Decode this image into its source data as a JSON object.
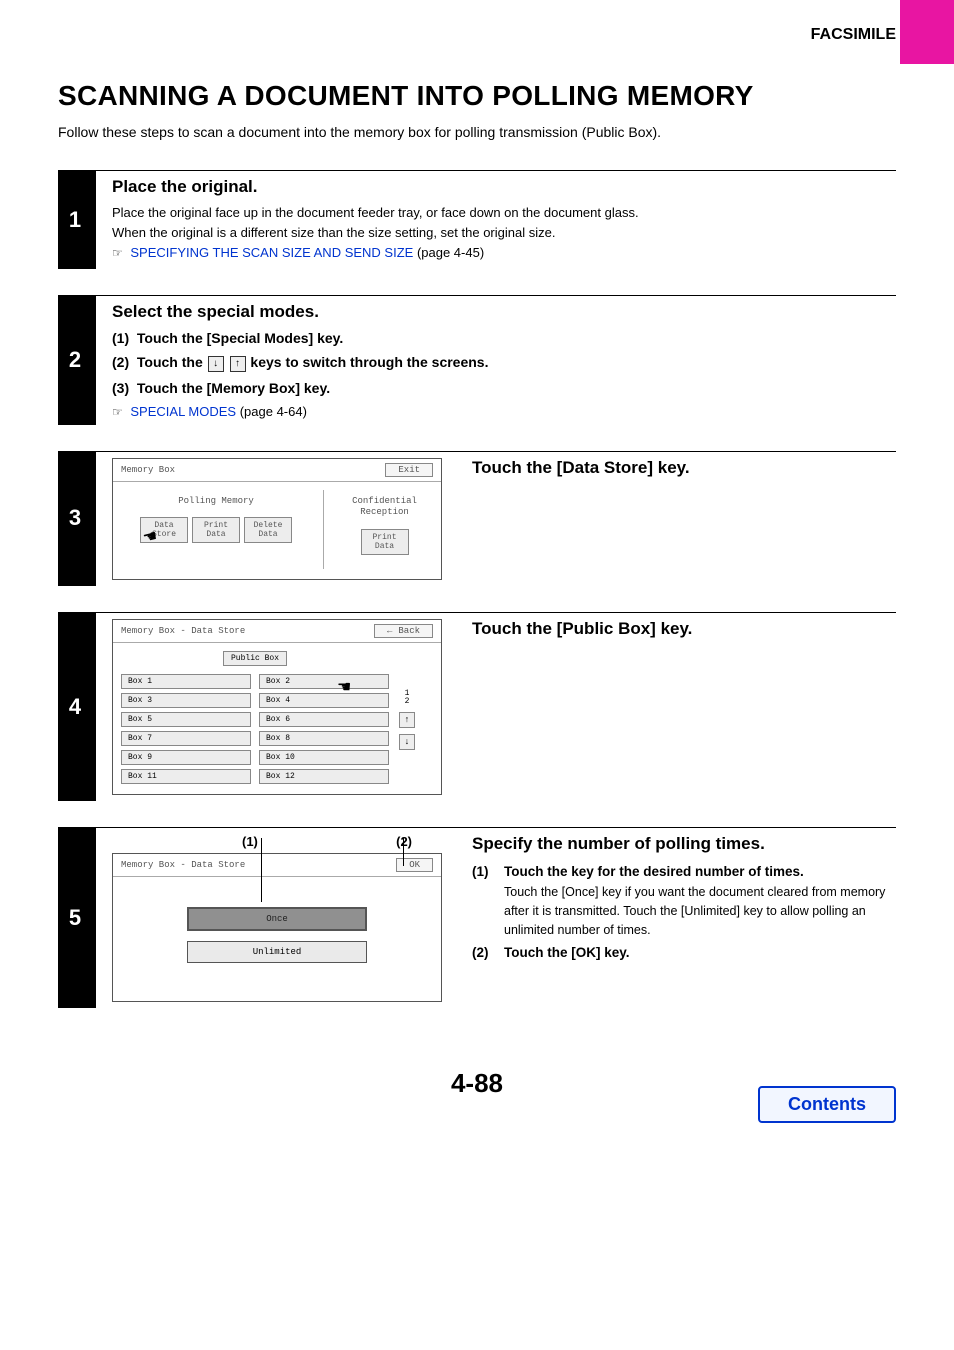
{
  "header": {
    "section": "FACSIMILE"
  },
  "title": "SCANNING A DOCUMENT INTO POLLING MEMORY",
  "intro": "Follow these steps to scan a document into the memory box for polling transmission (Public Box).",
  "page_number": "4-88",
  "contents_label": "Contents",
  "steps": {
    "s1": {
      "num": "1",
      "heading": "Place the original.",
      "body_a": "Place the original face up in the document feeder tray, or face down on the document glass.",
      "body_b": "When the original is a different size than the size setting, set the original size.",
      "link": "SPECIFYING THE SCAN SIZE AND SEND SIZE",
      "link_suffix": " (page 4-45)"
    },
    "s2": {
      "num": "2",
      "heading": "Select the special modes.",
      "items": {
        "a_idx": "(1)",
        "a": "Touch the [Special Modes] key.",
        "b_idx": "(2)",
        "b_pre": "Touch the ",
        "b_post": " keys to switch through the screens.",
        "c_idx": "(3)",
        "c": "Touch the [Memory Box] key."
      },
      "link": "SPECIAL MODES",
      "link_suffix": " (page 4-64)"
    },
    "s3": {
      "num": "3",
      "heading": "Touch the [Data Store] key.",
      "screen": {
        "title": "Memory Box",
        "exit": "Exit",
        "col1_title": "Polling Memory",
        "col2_title": "Confidential Reception",
        "keys": {
          "data_store": "Data Store",
          "print_data": "Print Data",
          "delete_data": "Delete Data",
          "print_data2": "Print Data"
        }
      }
    },
    "s4": {
      "num": "4",
      "heading": "Touch the [Public Box] key.",
      "screen": {
        "title": "Memory Box - Data Store",
        "back": "Back",
        "public": "Public Box",
        "page_ind_top": "1",
        "page_ind_bot": "2",
        "boxes": [
          "Box 1",
          "Box 2",
          "Box 3",
          "Box 4",
          "Box 5",
          "Box 6",
          "Box 7",
          "Box 8",
          "Box 9",
          "Box 10",
          "Box 11",
          "Box 12"
        ]
      }
    },
    "s5": {
      "num": "5",
      "callout1": "(1)",
      "callout2": "(2)",
      "heading": "Specify the number of polling times.",
      "sub1_idx": "(1)",
      "sub1": "Touch the key for the desired number of times.",
      "sub1_body": "Touch the [Once] key if you want the document cleared from memory after it is transmitted. Touch the [Unlimited] key to allow polling an unlimited number of times.",
      "sub2_idx": "(2)",
      "sub2": "Touch the [OK] key.",
      "screen": {
        "title": "Memory Box - Data Store",
        "ok": "OK",
        "once": "Once",
        "unlimited": "Unlimited"
      }
    }
  }
}
